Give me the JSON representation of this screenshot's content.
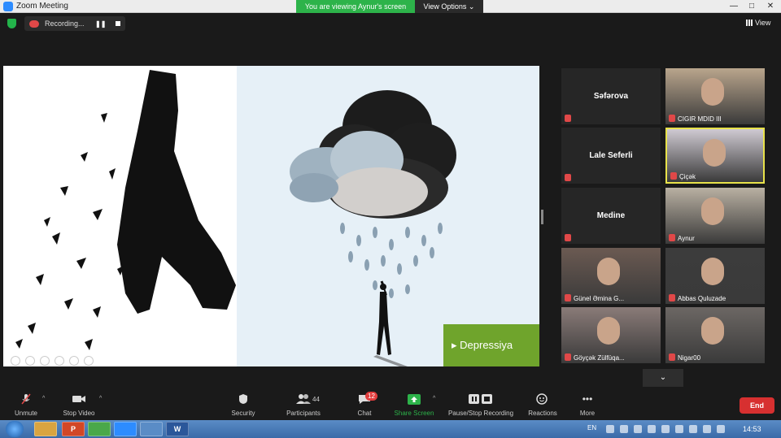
{
  "window": {
    "title": "Zoom Meeting",
    "banner": "You are viewing Aynur's screen",
    "view_options": "View Options ⌄",
    "minimize": "—",
    "maximize": "□",
    "close": "✕"
  },
  "recording": {
    "label": "Recording...",
    "pause": "❚❚"
  },
  "view_button": "View",
  "shared_screen": {
    "slide_caption": "Depressiya"
  },
  "gallery": [
    {
      "name": "Səfərova",
      "label": "",
      "video": false
    },
    {
      "name": "",
      "label": "CIGIR MDID III",
      "video": true,
      "bg": "#b9a58c"
    },
    {
      "name": "Lale Seferli",
      "label": "",
      "video": false
    },
    {
      "name": "",
      "label": "Çiçək",
      "video": true,
      "bg": "#cfcad2",
      "active": true
    },
    {
      "name": "Medine",
      "label": "",
      "video": false
    },
    {
      "name": "",
      "label": "Aynur",
      "video": true,
      "bg": "#b9b0a2"
    },
    {
      "name": "",
      "label": "Günel Əmina G...",
      "video": true,
      "bg": "#6b5a52"
    },
    {
      "name": "",
      "label": "Abbas Quluzade",
      "video": true,
      "bg": "#3c3c3c"
    },
    {
      "name": "",
      "label": "Göyçək Zülfüqa...",
      "video": true,
      "bg": "#8a7b78"
    },
    {
      "name": "",
      "label": "Nigar00",
      "video": true,
      "bg": "#6c6764"
    }
  ],
  "gallery_scroll": "⌄",
  "toolbar": {
    "unmute": "Unmute",
    "stop_video": "Stop Video",
    "security": "Security",
    "participants": "Participants",
    "participants_count": "44",
    "chat": "Chat",
    "chat_badge": "12",
    "share_screen": "Share Screen",
    "pause_stop": "Pause/Stop Recording",
    "reactions": "Reactions",
    "more": "More",
    "end": "End",
    "caret": "^"
  },
  "taskbar": {
    "apps": [
      "",
      "P",
      "",
      "",
      "",
      "W"
    ],
    "lang": "EN",
    "clock": "14:53"
  },
  "colors": {
    "share_green": "#2db34a",
    "end_red": "#d73030",
    "caption_green": "#6fa42c"
  }
}
